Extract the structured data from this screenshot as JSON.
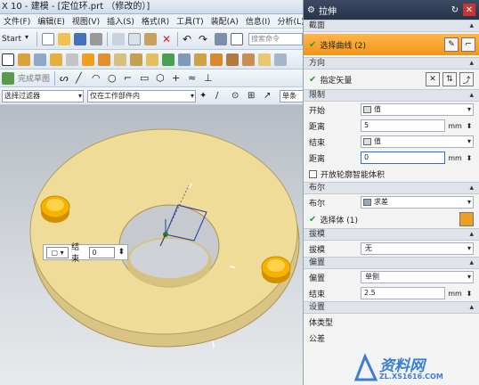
{
  "window": {
    "title": "X 10 - 建模 - [定位环.prt （修改的）]"
  },
  "menu": [
    "文件(F)",
    "编辑(E)",
    "视图(V)",
    "插入(S)",
    "格式(R)",
    "工具(T)",
    "装配(A)",
    "信息(I)",
    "分析(L)"
  ],
  "toolbar": {
    "start_label": "Start",
    "search_placeholder": "搜索命令",
    "finish_sketch": "完成草图",
    "filter_label": "选择过滤器",
    "scope_label": "仅在工作部件内",
    "single_label": "单条"
  },
  "floating_toolbar": {
    "label": "结束",
    "value": "0"
  },
  "dialog": {
    "title": "拉伸",
    "section": {
      "header": "截面",
      "selected_curves": "选择曲线 (2)"
    },
    "direction": {
      "header": "方向",
      "specify_vector": "指定矢量"
    },
    "limits": {
      "header": "限制",
      "start_label": "开始",
      "start_value": "值",
      "start_distance_label": "距离",
      "start_distance": "5",
      "end_label": "结束",
      "end_value": "值",
      "end_distance_label": "距离",
      "end_distance": "0",
      "unit": "mm",
      "open_profile": "开放轮廓智能体积"
    },
    "boolean": {
      "header": "布尔",
      "label": "布尔",
      "value": "求差",
      "select_body": "选择体 (1)"
    },
    "draft": {
      "header": "拔模",
      "label": "拔模",
      "value": "无"
    },
    "offset": {
      "header": "偏置",
      "label": "偏置",
      "value": "单侧",
      "end_label": "结束",
      "end_value": "2.5",
      "unit": "mm"
    },
    "settings": {
      "header": "设置",
      "body_type_label": "体类型",
      "tolerance_label": "公差"
    }
  },
  "watermark": {
    "brand": "资料网",
    "url": "ZL.XS1616.COM"
  },
  "colors": {
    "part_face": "#eedc98",
    "part_edge": "#a8924e",
    "pin": "#f5b300",
    "selection_bar": "#f39418",
    "dialog_title": "#2f3d54"
  }
}
